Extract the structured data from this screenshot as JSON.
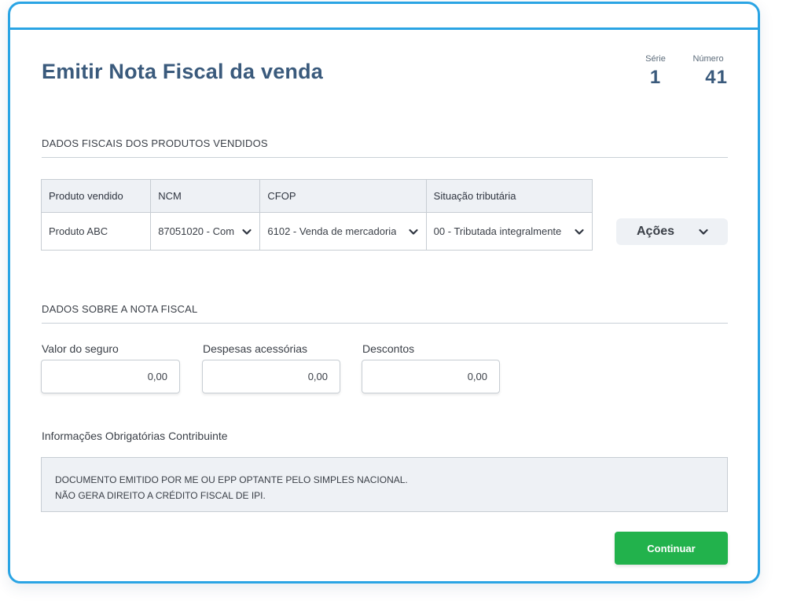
{
  "page": {
    "title": "Emitir Nota Fiscal da venda",
    "serie_label": "Série",
    "serie_value": "1",
    "numero_label": "Número",
    "numero_value": "41"
  },
  "produtos_section": {
    "title": "DADOS FISCAIS DOS PRODUTOS VENDIDOS",
    "columns": [
      "Produto vendido",
      "NCM",
      "CFOP",
      "Situação tributária"
    ],
    "rows": [
      {
        "produto": "Produto ABC",
        "ncm": "87051020 - Com",
        "cfop": "6102 - Venda de mercadoria",
        "situacao": "00 - Tributada integralmente"
      }
    ],
    "acoes_label": "Ações"
  },
  "nota_section": {
    "title": "DADOS SOBRE A NOTA FISCAL",
    "fields": [
      {
        "label": "Valor do seguro",
        "value": "0,00"
      },
      {
        "label": "Despesas acessórias",
        "value": "0,00"
      },
      {
        "label": "Descontos",
        "value": "0,00"
      }
    ],
    "info_label": "Informações Obrigatórias Contribuinte",
    "info_lines": [
      "DOCUMENTO EMITIDO POR ME OU EPP OPTANTE PELO SIMPLES NACIONAL.",
      "NÃO GERA DIREITO A CRÉDITO FISCAL DE IPI."
    ]
  },
  "actions": {
    "continuar_label": "Continuar"
  },
  "colors": {
    "accent_border": "#2aa4e4",
    "title": "#3a5a7c",
    "primary_button": "#22b24c",
    "panel_bg": "#eef1f5"
  }
}
